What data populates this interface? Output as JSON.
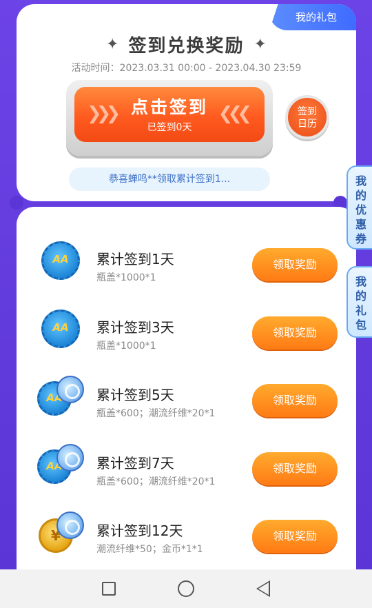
{
  "header": {
    "gift_tab": "我的礼包",
    "title": "签到兑换奖励",
    "title_deco": "✦",
    "activity_time": "活动时间：2023.03.31 00:00 - 2023.04.30 23:59"
  },
  "signin": {
    "button_label": "点击签到",
    "status": "已签到0天",
    "calendar_label_line1": "签到",
    "calendar_label_line2": "日历"
  },
  "ticker": {
    "text": "恭喜蝉鸣**领取累计签到1..."
  },
  "side_tabs": {
    "coupon": [
      "我",
      "的",
      "优",
      "惠",
      "券"
    ],
    "gift": [
      "我",
      "的",
      "礼",
      "包"
    ]
  },
  "rewards": [
    {
      "name": "累计签到1天",
      "desc": "瓶盖*1000*1",
      "button": "领取奖励",
      "icons": [
        "bottle-cap"
      ]
    },
    {
      "name": "累计签到3天",
      "desc": "瓶盖*1000*1",
      "button": "领取奖励",
      "icons": [
        "bottle-cap"
      ]
    },
    {
      "name": "累计签到5天",
      "desc": "瓶盖*600；潮流纤维*20*1",
      "button": "领取奖励",
      "icons": [
        "bottle-cap",
        "fiber"
      ]
    },
    {
      "name": "累计签到7天",
      "desc": "瓶盖*600；潮流纤维*20*1",
      "button": "领取奖励",
      "icons": [
        "bottle-cap",
        "fiber"
      ]
    },
    {
      "name": "累计签到12天",
      "desc": "潮流纤维*50；金币*1*1",
      "button": "领取奖励",
      "icons": [
        "gold-coin",
        "fiber"
      ]
    }
  ],
  "colors": {
    "background": "#5b35d6",
    "signin_button": "#ff5a1f",
    "claim_button": "#ff8a1c",
    "gift_tab": "#4a78ff"
  }
}
